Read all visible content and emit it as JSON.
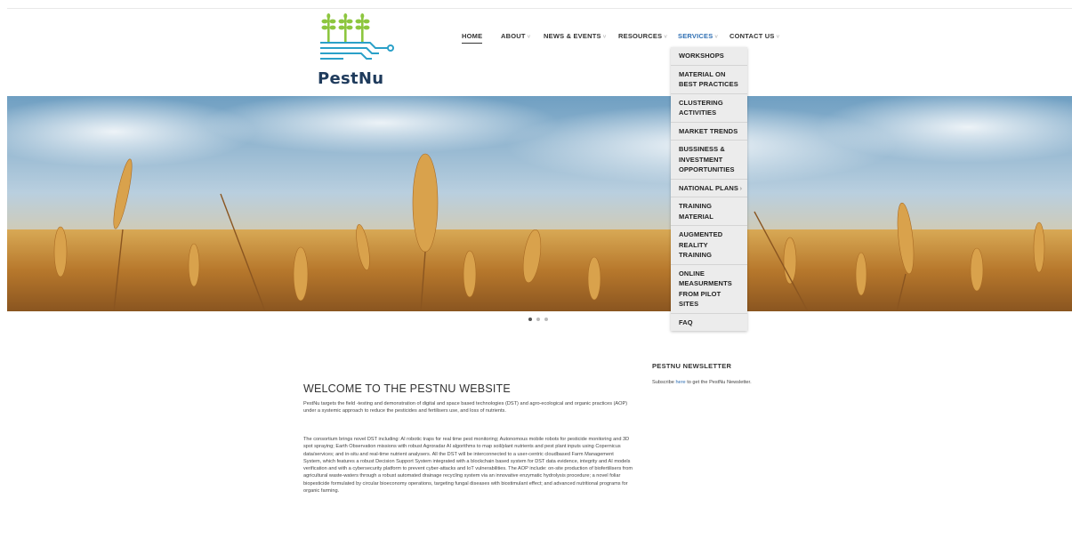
{
  "logo": {
    "text": "PestNu",
    "leaf_color": "#8dc63f",
    "circuit_color": "#2aa0c8"
  },
  "nav": {
    "home": "HOME",
    "about": "ABOUT",
    "news": "NEWS & EVENTS",
    "resources": "RESOURCES",
    "services": "SERVICES",
    "contact": "CONTACT US"
  },
  "dropdown": {
    "items": [
      "WORKSHOPS",
      "MATERIAL ON BEST PRACTICES",
      "CLUSTERING ACTIVITIES",
      "MARKET TRENDS",
      "BUSSINESS & INVESTMENT OPPORTUNITIES",
      "NATIONAL PLANS",
      "TRAINING MATERIAL",
      "AUGMENTED REALITY TRAINING",
      "ONLINE MEASURMENTS FROM PILOT SITES",
      "FAQ"
    ],
    "submenu_arrow": "›"
  },
  "carousel": {
    "slides": 3,
    "active": 1
  },
  "welcome": {
    "title": "WELCOME TO THE PESTNU WEBSITE",
    "para1": "PestNu targets the field -testing and demonstration of digital and space based technologies (DST) and agro-ecological and organic practices (AOP) under a systemic approach to reduce the pesticides and fertilisers use, and loss of nutrients.",
    "para2": "The consortium brings novel DST including: AI robotic traps for real time pest monitoring; Autonomous mobile robots for pesticide monitoring and 3D spot spraying; Earth Observation missions with robust Agroradar AI algorithms to map soil/plant nutrients and pest plant inputs using Copernicus data/services; and in-situ and real-time nutrient analysers. All the DST will be interconnected to a user-centric cloudbased Farm Management System, which features a robust Decision Support System integrated with a blockchain based system for DST data evidence, integrity and AI models verification and with a cybersecurity platform to prevent cyber-attacks and IoT vulnerabilities. The AOP include: on-site production of biofertilisers from agricultural waste-waters through a robust automated drainage recycling system via an innovative enzymatic hydrolysis procedure; a novel foliar biopesticide formulated by circular bioeconomy operations, targeting fungal diseases with biostimulant effect; and advanced nutritional programs for organic farming."
  },
  "newsletter": {
    "title": "PESTNU NEWSLETTER",
    "text_before": "Subscribe ",
    "link": "here",
    "text_after": " to get the PestNu Newsletter."
  }
}
